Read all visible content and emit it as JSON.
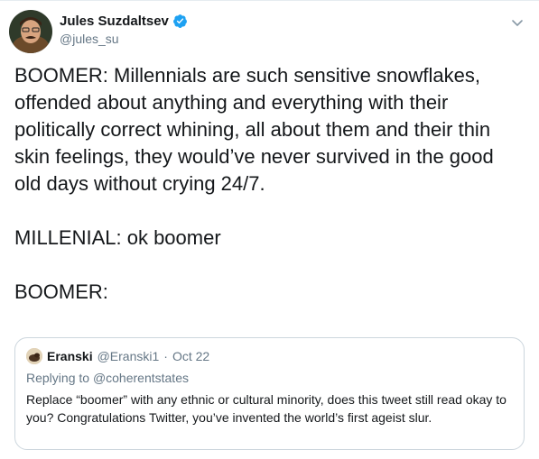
{
  "author": {
    "display_name": "Jules Suzdaltsev",
    "handle": "@jules_su",
    "verified": true
  },
  "tweet": {
    "paragraphs": [
      "BOOMER: Millennials are such sensitive snowflakes, offended about anything and everything with their politically correct whining, all about them and their thin skin feelings, they would’ve never survived in the good old days without crying 24/7.",
      "MILLENIAL: ok boomer",
      "BOOMER:"
    ]
  },
  "quoted": {
    "display_name": "Eranski",
    "handle": "@Eranski1",
    "date": "Oct 22",
    "replying_prefix": "Replying to",
    "replying_to": "@coherentstates",
    "text": "Replace “boomer” with any ethnic or cultural minority, does this tweet still read okay to you? Congratulations Twitter, you’ve invented the world’s first ageist slur."
  },
  "colors": {
    "link": "#1da1f2",
    "secondary_text": "#657786",
    "border": "#ccd6dd"
  },
  "icons": {
    "verified": "verified-badge-icon",
    "caret": "chevron-down-icon"
  }
}
